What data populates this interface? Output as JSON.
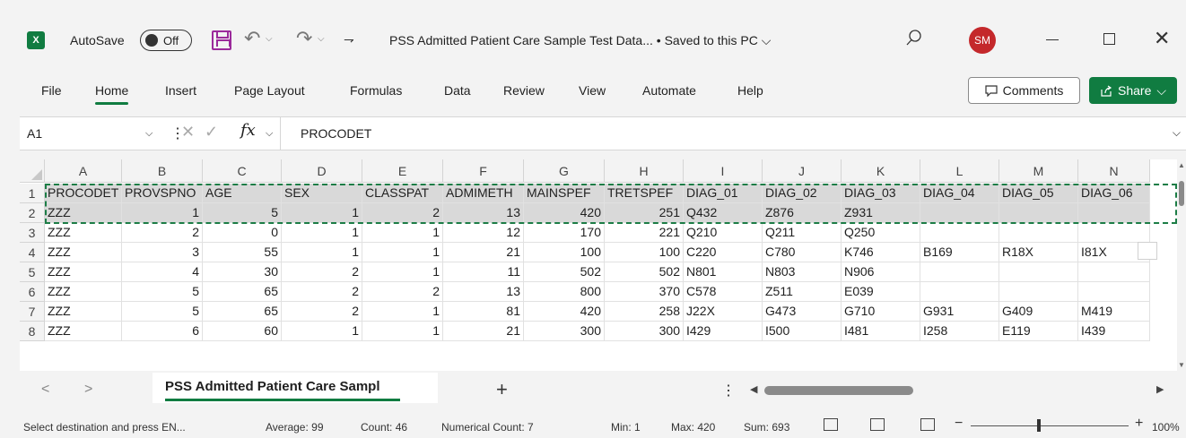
{
  "titlebar": {
    "app_logo": "X",
    "autosave_label": "AutoSave",
    "autosave_state": "Off",
    "doc_title": "PSS Admitted Patient Care Sample Test Data... • Saved to this PC ⌵",
    "user_initials": "SM",
    "undo_glyph": "↶",
    "redo_glyph": "↷",
    "dropdown_glyph": "⌵",
    "customize_glyph": "⇁",
    "minimize_label": "",
    "close_glyph": "✕"
  },
  "ribbon": {
    "tabs": [
      "File",
      "Home",
      "Insert",
      "Page Layout",
      "Formulas",
      "Data",
      "Review",
      "View",
      "Automate",
      "Help"
    ],
    "active_tab": "Home",
    "comments_label": "Comments",
    "share_label": "Share"
  },
  "formula_bar": {
    "name_box": "A1",
    "fx_label": "fx",
    "value": "PROCODET"
  },
  "grid": {
    "columns": [
      "A",
      "B",
      "C",
      "D",
      "E",
      "F",
      "G",
      "H",
      "I",
      "J",
      "K",
      "L",
      "M",
      "N"
    ],
    "row_numbers": [
      "1",
      "2",
      "3",
      "4",
      "5",
      "6",
      "7",
      "8"
    ],
    "rows": [
      [
        "PROCODET",
        "PROVSPNO",
        "AGE",
        "SEX",
        "CLASSPAT",
        "ADMIMETH",
        "MAINSPEF",
        "TRETSPEF",
        "DIAG_01",
        "DIAG_02",
        "DIAG_03",
        "DIAG_04",
        "DIAG_05",
        "DIAG_06"
      ],
      [
        "ZZZ",
        "1",
        "5",
        "1",
        "2",
        "13",
        "420",
        "251",
        "Q432",
        "Z876",
        "Z931",
        "",
        "",
        ""
      ],
      [
        "ZZZ",
        "2",
        "0",
        "1",
        "1",
        "12",
        "170",
        "221",
        "Q210",
        "Q211",
        "Q250",
        "",
        "",
        ""
      ],
      [
        "ZZZ",
        "3",
        "55",
        "1",
        "1",
        "21",
        "100",
        "100",
        "C220",
        "C780",
        "K746",
        "B169",
        "R18X",
        "I81X"
      ],
      [
        "ZZZ",
        "4",
        "30",
        "2",
        "1",
        "11",
        "502",
        "502",
        "N801",
        "N803",
        "N906",
        "",
        "",
        ""
      ],
      [
        "ZZZ",
        "5",
        "65",
        "2",
        "2",
        "13",
        "800",
        "370",
        "C578",
        "Z511",
        "E039",
        "",
        "",
        ""
      ],
      [
        "ZZZ",
        "5",
        "65",
        "2",
        "1",
        "81",
        "420",
        "258",
        "J22X",
        "G473",
        "G710",
        "G931",
        "G409",
        "M419"
      ],
      [
        "ZZZ",
        "6",
        "60",
        "1",
        "1",
        "21",
        "300",
        "300",
        "I429",
        "I500",
        "I481",
        "I258",
        "E119",
        "I439"
      ]
    ]
  },
  "sheets": {
    "active": "PSS Admitted Patient Care Sampl",
    "add_glyph": "+",
    "more_glyph": "⋮",
    "prev_glyph": "<",
    "next_glyph": ">",
    "scroll_left": "◀",
    "scroll_right": "▶"
  },
  "status": {
    "message": "Select destination and press EN...",
    "average": "Average: 99",
    "count": "Count: 46",
    "numerical_count": "Numerical Count: 7",
    "min": "Min: 1",
    "max": "Max: 420",
    "sum": "Sum: 693",
    "zoom": "100%",
    "zoom_minus": "−",
    "zoom_plus": "+"
  }
}
